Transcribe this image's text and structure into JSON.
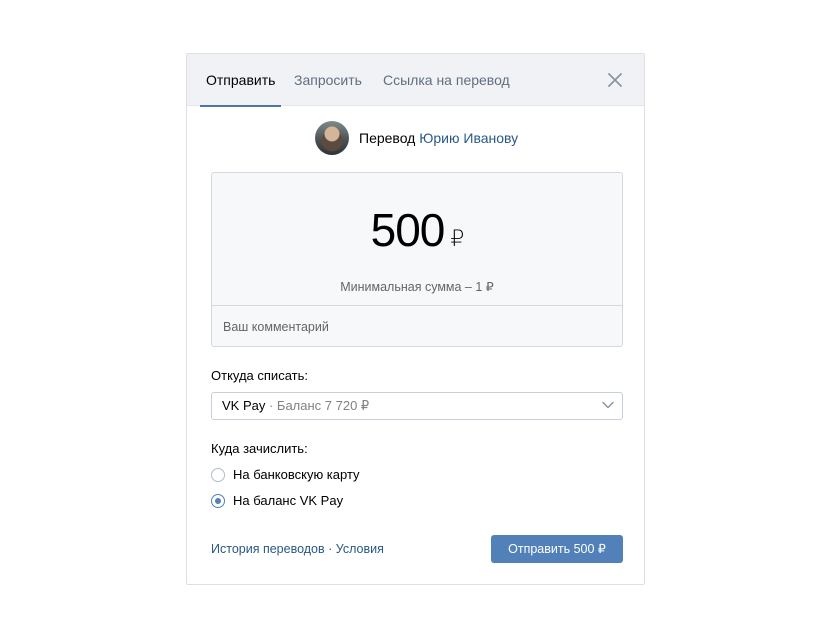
{
  "tabs": [
    {
      "label": "Отправить",
      "active": true
    },
    {
      "label": "Запросить",
      "active": false
    },
    {
      "label": "Ссылка на перевод",
      "active": false
    }
  ],
  "close_icon": "close-icon",
  "recipient": {
    "prefix": "Перевод",
    "name": "Юрию Иванову"
  },
  "amount": {
    "value": "500",
    "currency": "₽",
    "min_note": "Минимальная сумма – 1 ₽",
    "comment_placeholder": "Ваш комментарий"
  },
  "source": {
    "label": "Откуда списать:",
    "selected_main": "VK Pay",
    "selected_detail": " · Баланс 7 720 ₽"
  },
  "destination": {
    "label": "Куда зачислить:",
    "options": [
      {
        "label": "На банковскую карту",
        "checked": false
      },
      {
        "label": "На баланс VK Pay",
        "checked": true
      }
    ]
  },
  "footer": {
    "history_link": "История переводов",
    "separator": " · ",
    "terms_link": "Условия",
    "send_button": "Отправить 500 ₽"
  },
  "colors": {
    "accent": "#5181b8",
    "link": "#2a5885",
    "tab_bar": "#f0f2f5"
  }
}
